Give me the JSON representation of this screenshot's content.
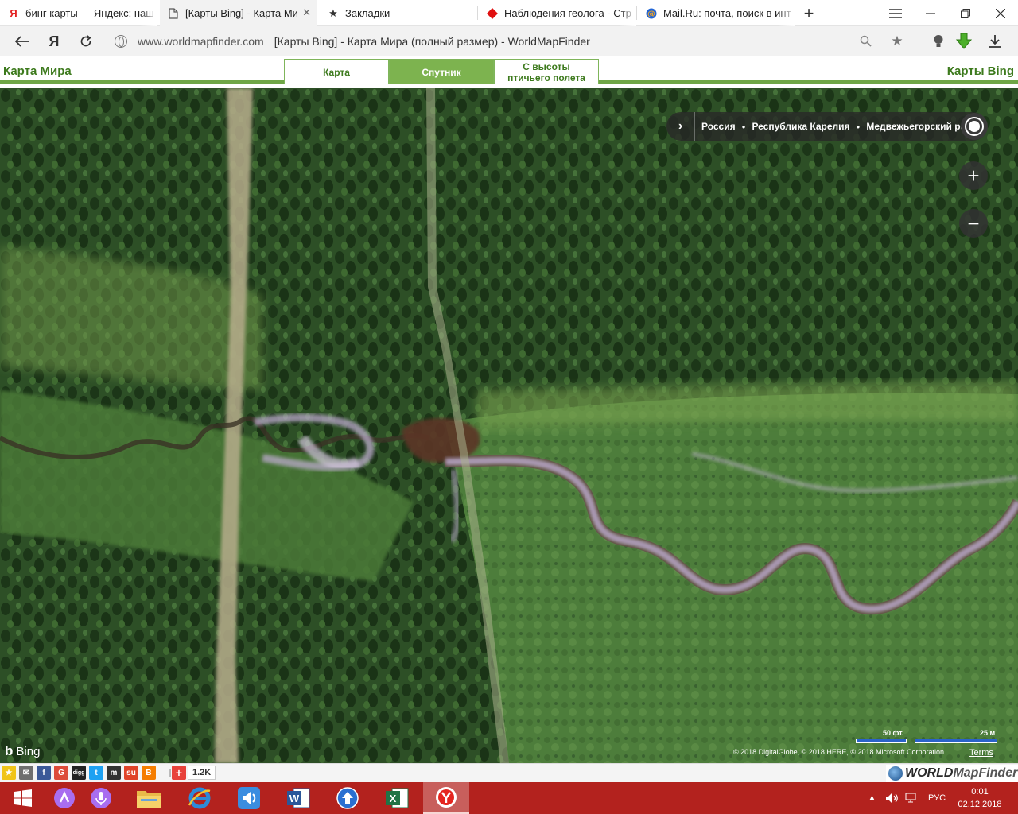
{
  "browser": {
    "tabs": [
      {
        "title": "бинг карты — Яндекс: наш",
        "icon": "yandex-icon"
      },
      {
        "title": "[Карты Bing] - Карта Ми",
        "icon": "page-icon",
        "active": true
      },
      {
        "title": "Закладки",
        "icon": "star-icon"
      },
      {
        "title": "Наблюдения геолога - Стр",
        "icon": "red-diamond-icon"
      },
      {
        "title": "Mail.Ru: почта, поиск в инт",
        "icon": "mail-at-icon"
      }
    ],
    "address": {
      "site": "www.worldmapfinder.com",
      "title": "[Карты Bing] - Карта Мира (полный размер) - WorldMapFinder"
    }
  },
  "site": {
    "left_title": "Карта Мира",
    "right_title": "Карты Bing",
    "view_tabs": [
      {
        "label": "Карта"
      },
      {
        "label": "Спутник",
        "active": true
      },
      {
        "label": "С высоты\nптичьего полета"
      }
    ]
  },
  "map": {
    "breadcrumb": [
      "Россия",
      "Республика Карелия",
      "Медвежьегорский район"
    ],
    "provider": "Bing",
    "scale_labels": [
      "50 фт.",
      "25 м"
    ],
    "copyright": "© 2018 DigitalGlobe, © 2018 HERE, © 2018 Microsoft Corporation",
    "terms": "Terms"
  },
  "share": {
    "count": "1.2K",
    "logo_part1": "WORLD",
    "logo_part2": "MapFinder"
  },
  "taskbar": {
    "language": "РУС",
    "time": "0:01",
    "date": "02.12.2018"
  },
  "colors": {
    "brand_green": "#3d7a1d",
    "tab_active_green": "#7db34f",
    "taskbar_red": "#b3221e"
  }
}
